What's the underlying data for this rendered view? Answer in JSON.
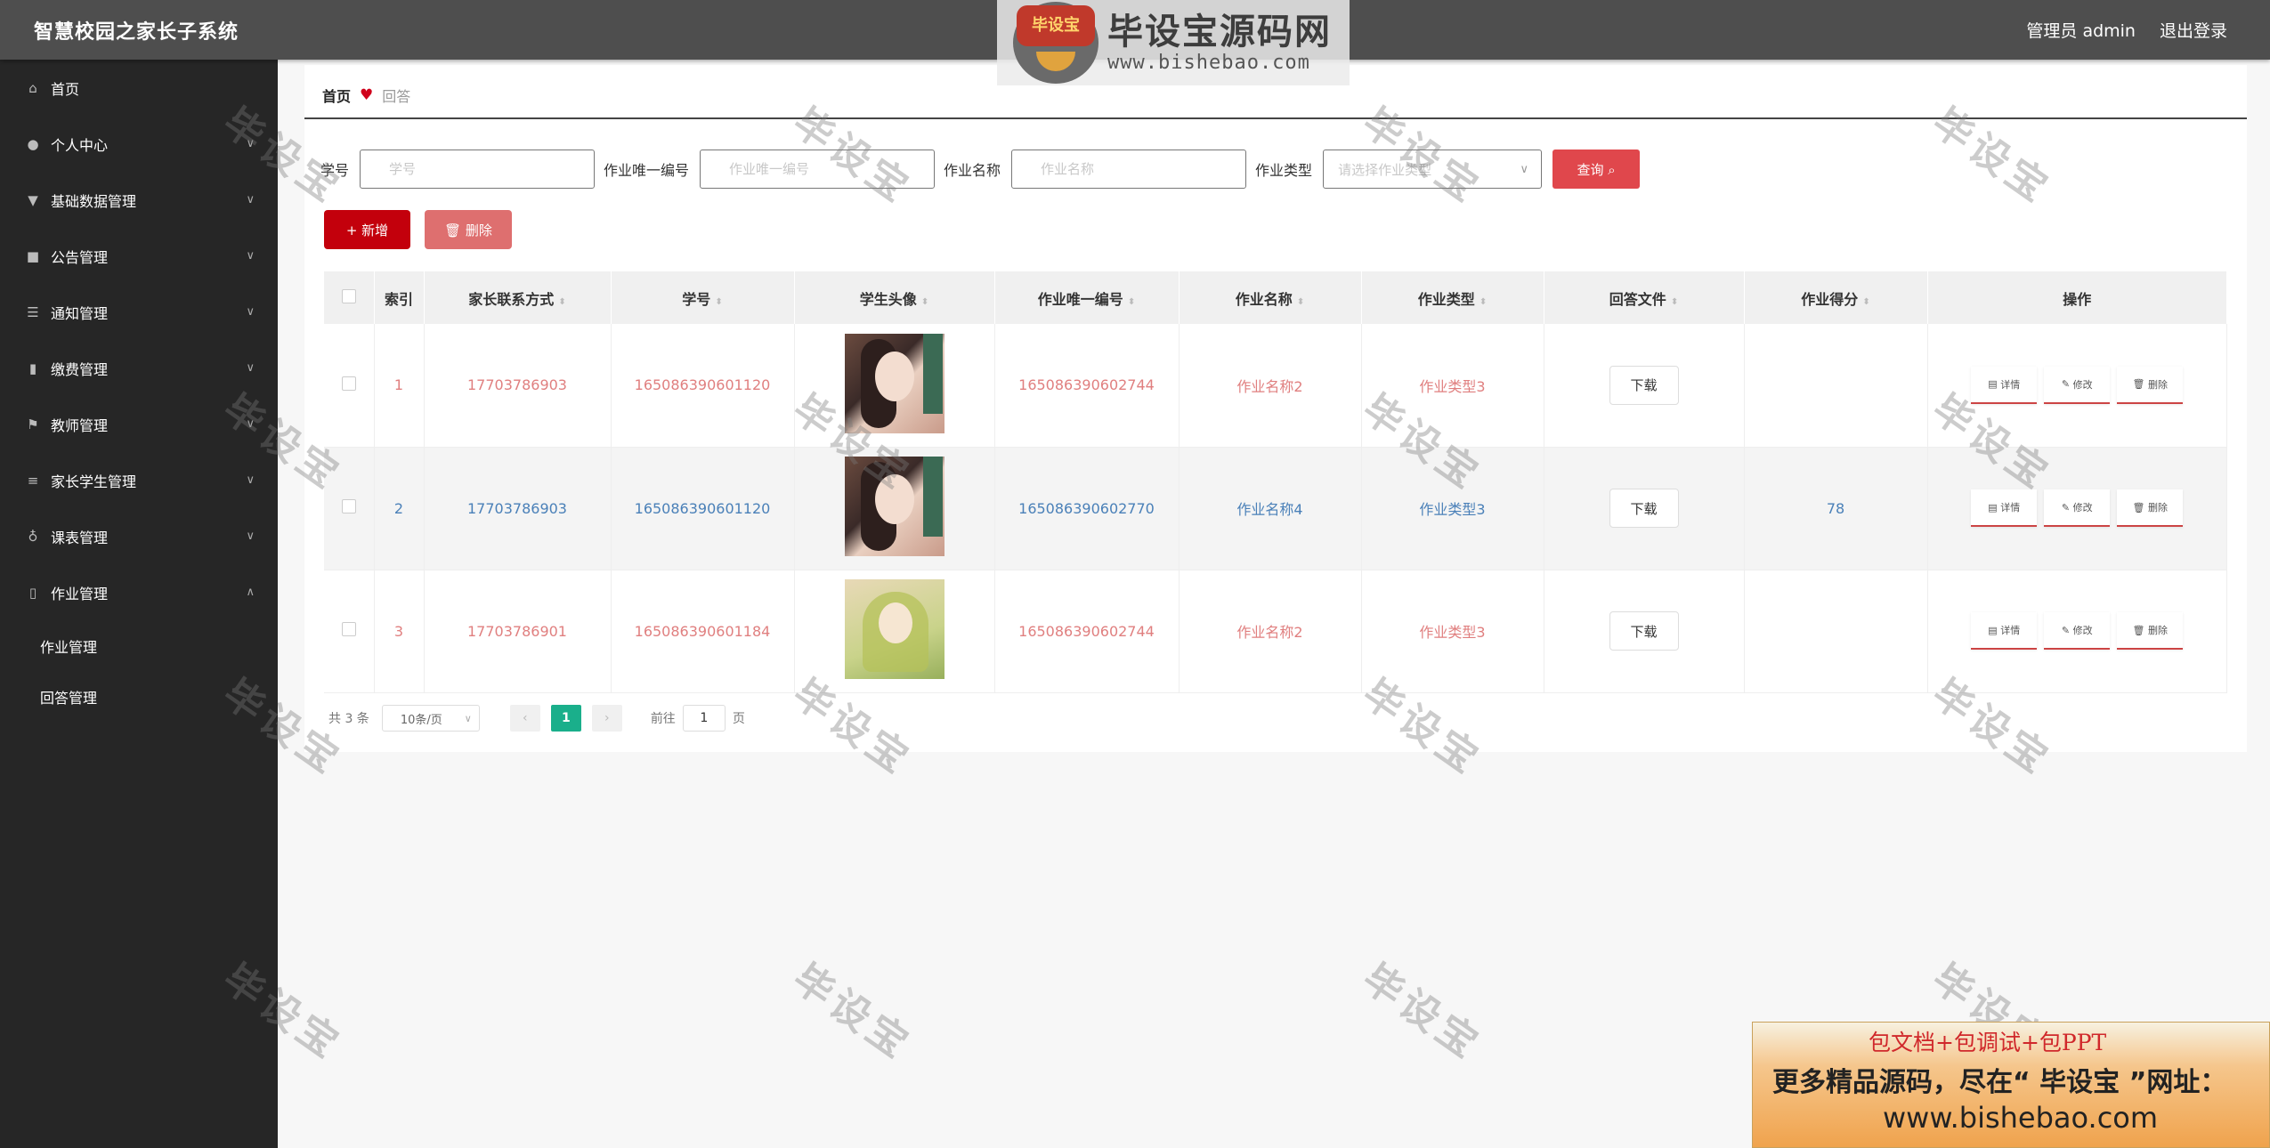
{
  "app": {
    "title": "智慧校园之家长子系统"
  },
  "topbar": {
    "user": "管理员 admin",
    "logout": "退出登录"
  },
  "logo_watermark": {
    "badge": "毕设宝",
    "name": "毕设宝源码网",
    "url": "www.bishebao.com"
  },
  "sidebar": {
    "items": [
      {
        "label": "首页",
        "icon": "home-icon"
      },
      {
        "label": "个人中心",
        "icon": "user-icon"
      },
      {
        "label": "基础数据管理",
        "icon": "trophy-icon"
      },
      {
        "label": "公告管理",
        "icon": "video-icon"
      },
      {
        "label": "通知管理",
        "icon": "sliders-icon"
      },
      {
        "label": "缴费管理",
        "icon": "bar-chart-icon"
      },
      {
        "label": "教师管理",
        "icon": "flag-icon"
      },
      {
        "label": "家长学生管理",
        "icon": "list-icon"
      },
      {
        "label": "课表管理",
        "icon": "microphone-icon"
      },
      {
        "label": "作业管理",
        "icon": "mobile-icon"
      }
    ],
    "subitems": [
      {
        "label": "作业管理"
      },
      {
        "label": "回答管理"
      }
    ]
  },
  "breadcrumb": {
    "home": "首页",
    "current": "回答"
  },
  "search": {
    "student_id_label": "学号",
    "student_id_placeholder": "学号",
    "hw_id_label": "作业唯一编号",
    "hw_id_placeholder": "作业唯一编号",
    "hw_name_label": "作业名称",
    "hw_name_placeholder": "作业名称",
    "hw_type_label": "作业类型",
    "hw_type_placeholder": "请选择作业类型",
    "query_button": "查询"
  },
  "actions": {
    "add": "新增",
    "delete": "删除"
  },
  "table": {
    "headers": [
      "索引",
      "家长联系方式",
      "学号",
      "学生头像",
      "作业唯一编号",
      "作业名称",
      "作业类型",
      "回答文件",
      "作业得分",
      "操作"
    ],
    "download_label": "下载",
    "op_labels": {
      "detail": "详情",
      "edit": "修改",
      "delete": "删除"
    },
    "rows": [
      {
        "index": "1",
        "phone": "17703786903",
        "student_id": "165086390601120",
        "hw_id": "165086390602744",
        "hw_name": "作业名称2",
        "hw_type": "作业类型3",
        "score": ""
      },
      {
        "index": "2",
        "phone": "17703786903",
        "student_id": "165086390601120",
        "hw_id": "165086390602770",
        "hw_name": "作业名称4",
        "hw_type": "作业类型3",
        "score": "78"
      },
      {
        "index": "3",
        "phone": "17703786901",
        "student_id": "165086390601184",
        "hw_id": "165086390602744",
        "hw_name": "作业名称2",
        "hw_type": "作业类型3",
        "score": ""
      }
    ]
  },
  "pagination": {
    "total": "共 3 条",
    "page_size": "10条/页",
    "current_page": "1",
    "goto_label": "前往",
    "goto_value": "1",
    "page_suffix": "页"
  },
  "watermark": {
    "text": "毕设宝"
  },
  "promo": {
    "line1": "包文档+包调试+包PPT",
    "line2": "更多精品源码，尽在“ 毕设宝 ”网址：",
    "line3": "www.bishebao.com"
  }
}
